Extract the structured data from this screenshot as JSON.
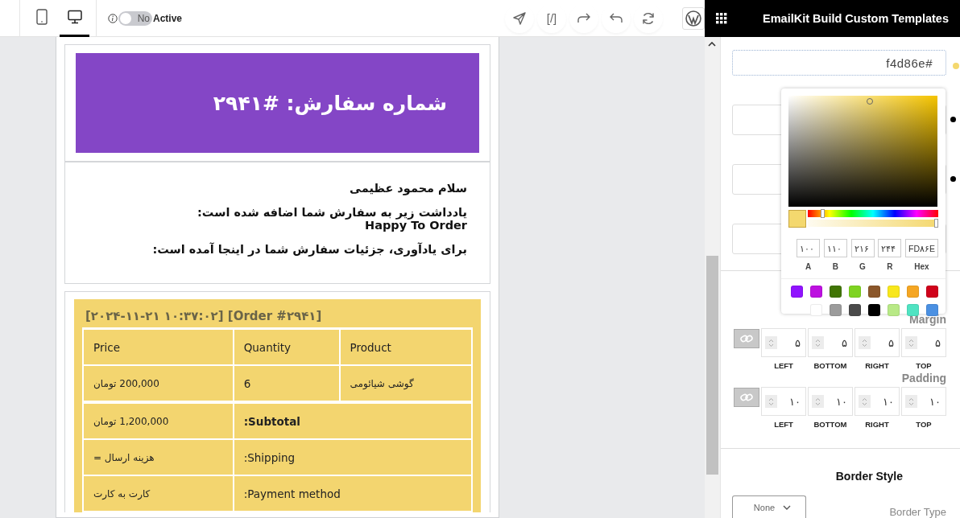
{
  "toolbar": {
    "devices": [
      {
        "kind": "tablet",
        "selected": false
      },
      {
        "kind": "desktop",
        "selected": true
      }
    ],
    "active_toggle": {
      "on": false,
      "state_label": "No",
      "label": "Active"
    },
    "actions": [
      {
        "kind": "send"
      },
      {
        "kind": "code",
        "label": "[/]"
      },
      {
        "kind": "redo"
      },
      {
        "kind": "undo"
      },
      {
        "kind": "refresh"
      }
    ]
  },
  "panel": {
    "title": "EmailKit Build Custom Templates",
    "color_field": {
      "value": "f4d86e#",
      "color": "#f4d86e"
    },
    "picker": {
      "hue": {
        "level": 0.12
      },
      "alpha": {
        "level": 1
      },
      "channels": [
        {
          "label": "Hex",
          "value": "FD۸۶E"
        },
        {
          "label": "R",
          "value": "۲۴۴"
        },
        {
          "label": "G",
          "value": "۲۱۶"
        },
        {
          "label": "B",
          "value": "۱۱۰"
        },
        {
          "label": "A",
          "value": "۱۰۰"
        }
      ],
      "presets": [
        [
          {
            "color": "#9013fe"
          },
          {
            "color": "#bd10e0"
          },
          {
            "color": "#417505"
          },
          {
            "color": "#7ed321"
          },
          {
            "color": "#8b572a"
          },
          {
            "color": "#f8e71c"
          },
          {
            "color": "#f5a623"
          },
          {
            "color": "#d0021b"
          }
        ],
        [
          {
            "color": "#ffffff"
          },
          {
            "color": "#9b9b9b"
          },
          {
            "color": "#4a4a4a"
          },
          {
            "color": "#000000"
          },
          {
            "color": "#b8e986"
          },
          {
            "color": "#50e3c2"
          },
          {
            "color": "#4a90e2"
          }
        ]
      ]
    },
    "spacing": [
      {
        "title": "Margin",
        "sides": [
          {
            "label": "TOP",
            "value": "۵"
          },
          {
            "label": "RIGHT",
            "value": "۵"
          },
          {
            "label": "BOTTOM",
            "value": "۵"
          },
          {
            "label": "LEFT",
            "value": "۵"
          }
        ]
      },
      {
        "title": "Padding",
        "sides": [
          {
            "label": "TOP",
            "value": "۱۰"
          },
          {
            "label": "RIGHT",
            "value": "۱۰"
          },
          {
            "label": "BOTTOM",
            "value": "۱۰"
          },
          {
            "label": "LEFT",
            "value": "۱۰"
          }
        ]
      }
    ],
    "border_style": {
      "title": "Border Style",
      "type_label": "Border Type",
      "type_value": "None"
    }
  },
  "email": {
    "heading": "شماره سفارش: #۲۹۴۱",
    "paragraphs": [
      {
        "text": "سلام محمود عظیمی"
      },
      {
        "text": "یادداشت زیر به سفارش شما اضافه شده است:",
        "note": "Happy To Order"
      },
      {
        "text": "برای یادآوری، جزئیات سفارش شما در اینجا آمده است:"
      }
    ],
    "order": {
      "title": "[Order #۲۹۴۱] [۲۰۲۴-۱۱-۲۱ ۱۰:۳۷:۰۲]",
      "columns": [
        "Product",
        "Quantity",
        "Price"
      ],
      "items": [
        [
          "گوشی شیائومی",
          "6",
          "200,000 تومان"
        ]
      ],
      "totals": [
        {
          "label": "Subtotal:",
          "value": "1,200,000 تومان",
          "bold": true
        },
        {
          "label": "Shipping:",
          "value": "هزینه ارسال =",
          "bold": false
        },
        {
          "label": "Payment method:",
          "value": "کارت به کارت",
          "bold": false
        }
      ]
    }
  }
}
